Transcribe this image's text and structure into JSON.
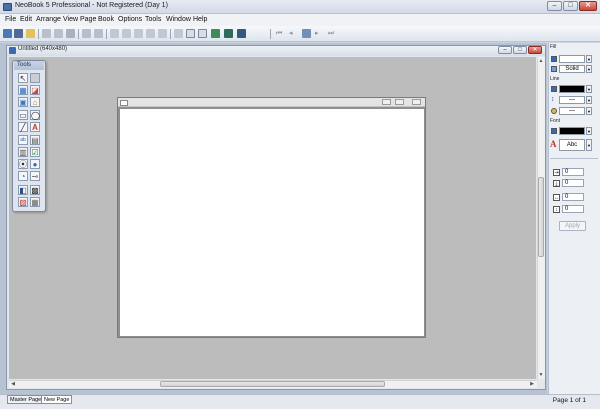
{
  "window": {
    "title": "NeoBook 5 Professional - Not Registered (Day 1)",
    "minimize": "–",
    "maximize": "□",
    "close": "✕"
  },
  "menu": [
    "File",
    "Edit",
    "Arrange",
    "View",
    "Page",
    "Book",
    "Options",
    "Tools",
    "Window",
    "Help"
  ],
  "document": {
    "title": "Untitled  (640x480)",
    "minimize": "–",
    "maximize": "□",
    "close": "✕"
  },
  "tools": {
    "title": "Tools"
  },
  "panel": {
    "fill_label": "Fill",
    "fill_style": "Solid",
    "line_label": "Line",
    "font_label": "Font",
    "font_sample": "Abc",
    "font_icon": "A",
    "spin_values": [
      "0",
      "0",
      "0",
      "0"
    ],
    "apply_label": "Apply",
    "fill_color": "#ffffff",
    "line_color": "#000000",
    "font_color": "#000000"
  },
  "status": {
    "tabs": [
      "Master Page",
      "New Page"
    ],
    "page_indicator": "Page 1 of 1"
  }
}
